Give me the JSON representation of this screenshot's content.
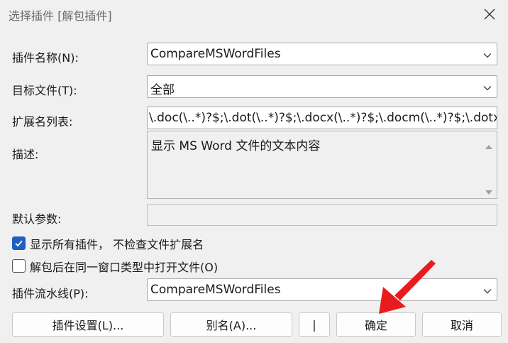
{
  "window": {
    "title": "选择插件 [解包插件]"
  },
  "icons": {
    "close": "close-icon",
    "chevron": "chevron-down-icon",
    "check": "checkmark-icon",
    "arrow": "red-arrow-annotation"
  },
  "colors": {
    "accent": "#1f5fc0",
    "arrow": "#e81c1c"
  },
  "form": {
    "plugin_name_label": "插件名称(N):",
    "plugin_name_value": "CompareMSWordFiles",
    "target_file_label": "目标文件(T):",
    "target_file_value": "全部",
    "ext_list_label": "扩展名列表:",
    "ext_list_value": "\\.doc(\\..*)?$;\\.dot(\\..*)?$;\\.docx(\\..*)?$;\\.docm(\\..*)?$;\\.dotx(",
    "description_label": "描述:",
    "description_value": "显示 MS Word 文件的文本内容",
    "default_params_label": "默认参数:",
    "default_params_value": "",
    "show_all_label": "显示所有插件， 不检查文件扩展名",
    "show_all_checked": true,
    "open_same_label": "解包后在同一窗口类型中打开文件(O)",
    "open_same_checked": false,
    "pipeline_label": "插件流水线(P):",
    "pipeline_value": "CompareMSWordFiles"
  },
  "buttons": {
    "settings": "插件设置(L)...",
    "alias": "别名(A)...",
    "pipe": "|",
    "ok": "确定",
    "cancel": "取消"
  }
}
